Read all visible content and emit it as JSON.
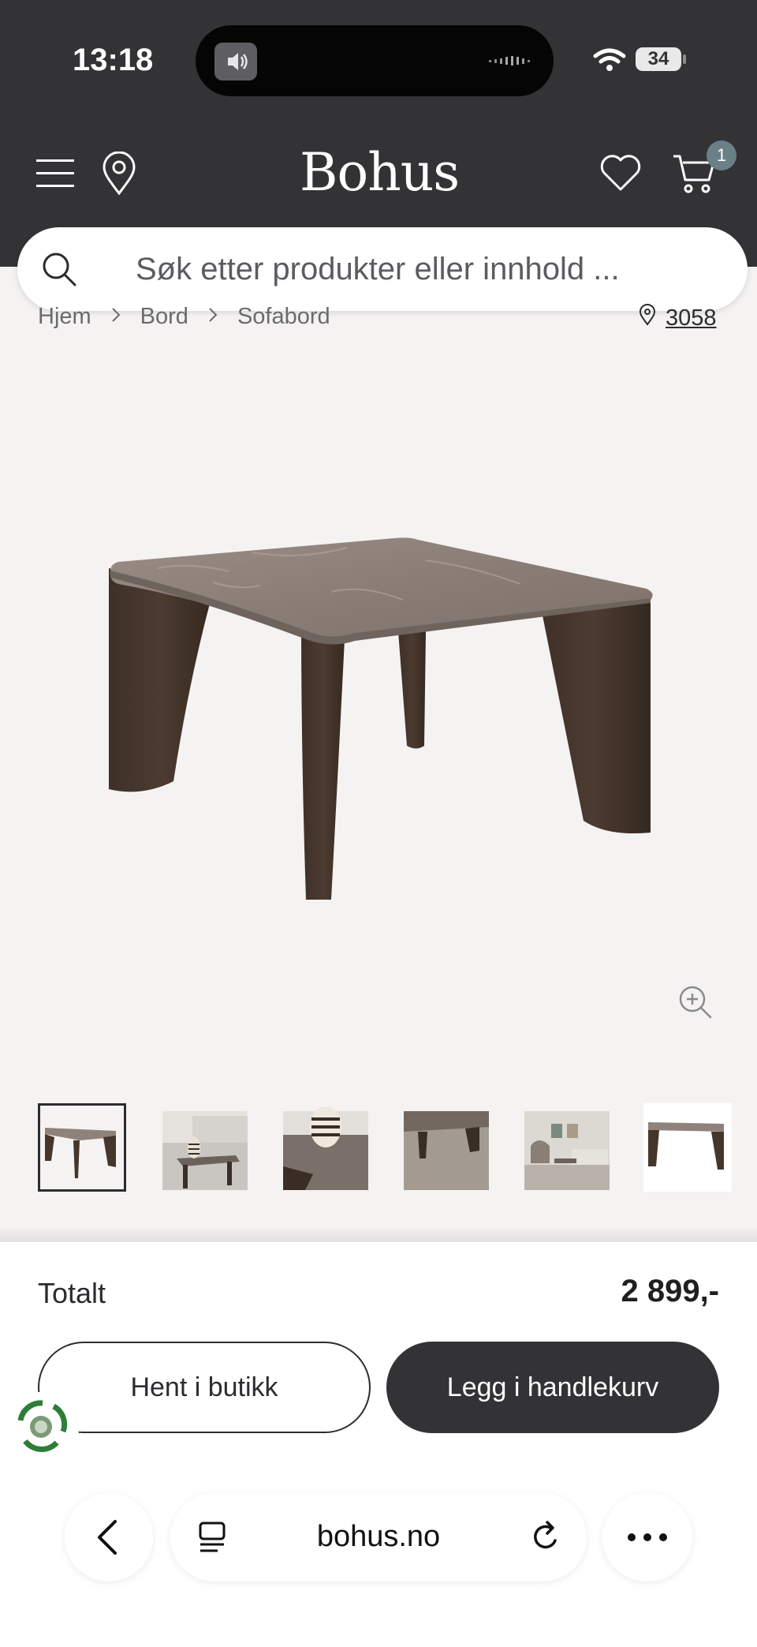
{
  "status_bar": {
    "time": "13:18",
    "battery": "34"
  },
  "header": {
    "logo": "Bohus",
    "cart_count": "1"
  },
  "search": {
    "placeholder": "Søk etter produkter eller innhold ..."
  },
  "breadcrumb": {
    "items": [
      "Hjem",
      "Bord",
      "Sofabord"
    ],
    "store_code": "3058"
  },
  "product": {
    "image_icon": "coffee-table-marble",
    "thumbnail_count": 6
  },
  "purchase": {
    "total_label": "Totalt",
    "total_price": "2 899,-",
    "pickup_label": "Hent i butikk",
    "add_to_cart_label": "Legg i handlekurv"
  },
  "browser": {
    "url": "bohus.no"
  },
  "colors": {
    "header_bg": "#333336",
    "page_bg": "#f5f3f2",
    "primary_button": "#333336",
    "badge": "#6a7f86",
    "eco_green": "#2e7d3a"
  }
}
